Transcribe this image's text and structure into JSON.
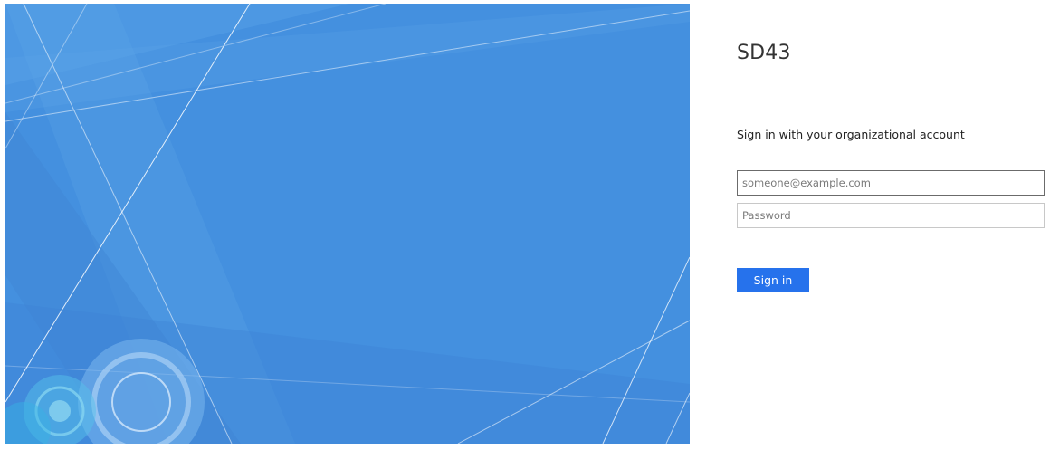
{
  "organization": {
    "name": "SD43"
  },
  "login": {
    "instruction": "Sign in with your organizational account",
    "email_placeholder": "someone@example.com",
    "email_value": "",
    "password_placeholder": "Password",
    "password_value": "",
    "signin_label": "Sign in"
  },
  "theme": {
    "illustration_color": "#4490df",
    "button_color": "#2672ec"
  }
}
